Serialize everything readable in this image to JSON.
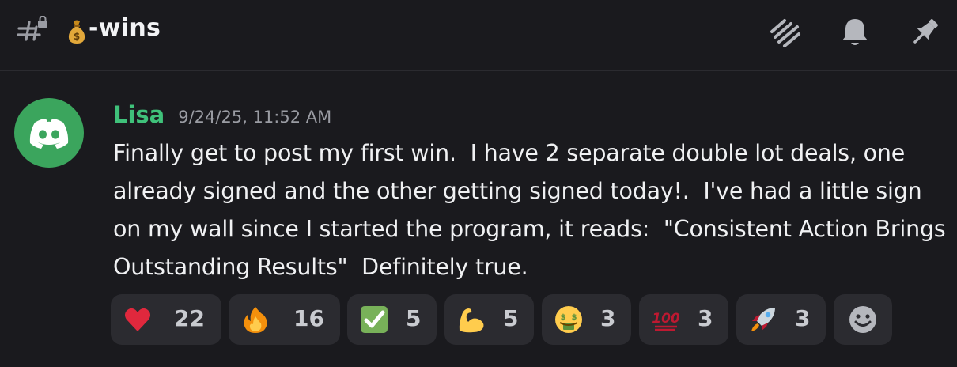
{
  "header": {
    "channel_icon": "hashtag-lock-icon",
    "channel_emoji": "money-bag-icon",
    "channel_name": "-wins",
    "actions": [
      {
        "name": "threads-icon"
      },
      {
        "name": "notification-bell-icon"
      },
      {
        "name": "pin-icon"
      }
    ]
  },
  "message": {
    "avatar": "discord-logo-icon",
    "author": "Lisa",
    "author_color": "#3fc17a",
    "timestamp": "9/24/25, 11:52 AM",
    "content": "Finally get to post my first win.  I have 2 separate double lot deals, one already signed and the other getting signed today!.  I've had a little sign on my wall since I started the program, it reads:  \"Consistent Action Brings Outstanding Results\"  Definitely true.",
    "reactions": [
      {
        "emoji": "heart-icon",
        "count": "22"
      },
      {
        "emoji": "fire-icon",
        "count": "16"
      },
      {
        "emoji": "check-mark-button-icon",
        "count": "5"
      },
      {
        "emoji": "flexed-biceps-icon",
        "count": "5"
      },
      {
        "emoji": "money-mouth-face-icon",
        "count": "3"
      },
      {
        "emoji": "hundred-points-icon",
        "count": "3"
      },
      {
        "emoji": "rocket-icon",
        "count": "3"
      }
    ],
    "add_reaction": "add-reaction-icon"
  }
}
